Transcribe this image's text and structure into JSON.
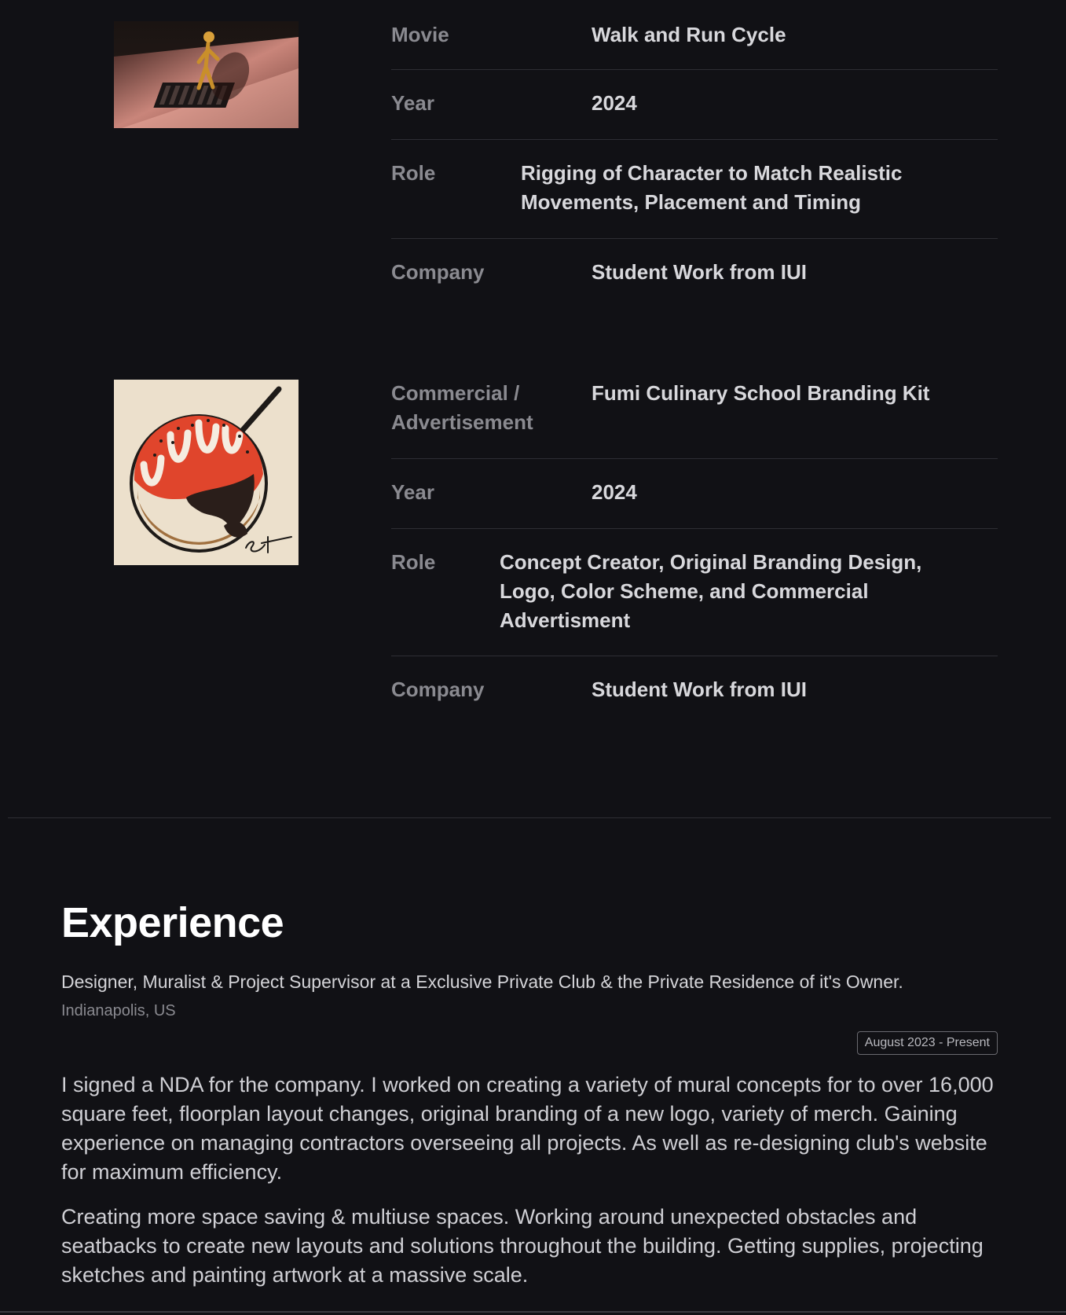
{
  "projects": [
    {
      "thumbnail": "walk-and-run-cycle-render",
      "rows": [
        {
          "key": "Movie",
          "value": "Walk and Run Cycle"
        },
        {
          "key": "Year",
          "value": "2024"
        },
        {
          "key": "Role",
          "value": "Rigging of Character to Match Realistic Movements, Placement and Timing"
        },
        {
          "key": "Company",
          "value": "Student Work from IUI"
        }
      ]
    },
    {
      "thumbnail": "fumi-culinary-logo",
      "rows": [
        {
          "key": "Commercial / Advertisement",
          "value": "Fumi Culinary School Branding Kit"
        },
        {
          "key": "Year",
          "value": "2024"
        },
        {
          "key": "Role",
          "value": "Concept Creator, Original Branding Design, Logo, Color Scheme, and Commercial Advertisment"
        },
        {
          "key": "Company",
          "value": "Student Work from IUI"
        }
      ]
    }
  ],
  "experience": {
    "heading": "Experience",
    "job_title": "Designer, Muralist & Project Supervisor at a Exclusive Private Club & the Private Residence of it's Owner.",
    "location": "Indianapolis, US",
    "dates": "August 2023 - Present",
    "paragraphs": [
      "I signed a NDA for the company. I worked on creating a variety of mural concepts for to over 16,000 square feet, floorplan layout changes, original branding of a new logo, variety of merch. Gaining experience on managing contractors overseeing all projects. As well as re-designing club's website for maximum efficiency.",
      "Creating more space saving & multiuse spaces. Working around unexpected obstacles and seatbacks to create new layouts and solutions throughout the building. Getting supplies, projecting sketches and painting artwork at a massive scale."
    ]
  },
  "colors": {
    "background": "#111115",
    "label": "#8a8a90",
    "value": "#d8d8dc",
    "logo_red": "#e0452c",
    "logo_cream": "#ece0cc"
  }
}
